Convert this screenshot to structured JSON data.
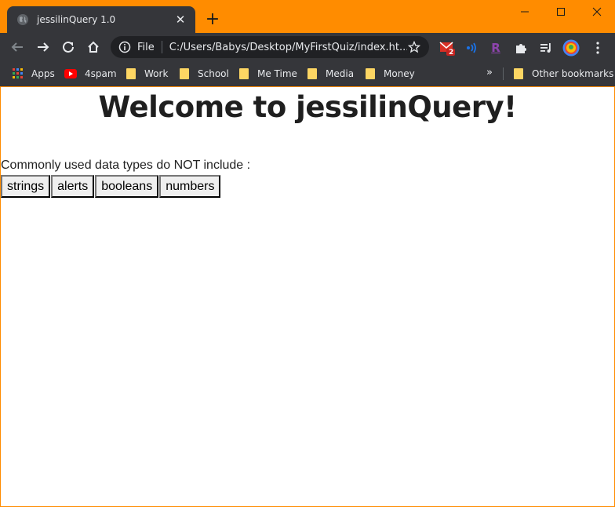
{
  "browser": {
    "tab": {
      "title": "jessilinQuery 1.0",
      "close_icon": "close-icon",
      "favicon": "globe-icon"
    },
    "new_tab_label": "+",
    "address_bar": {
      "scheme_label": "File",
      "url": "C:/Users/Babys/Desktop/MyFirstQuiz/index.ht..."
    },
    "extension_badge": "2",
    "bookmarks": [
      {
        "label": "Apps",
        "icon": "apps-grid-icon"
      },
      {
        "label": "4spam",
        "icon": "youtube-icon"
      },
      {
        "label": "Work",
        "icon": "folder-icon"
      },
      {
        "label": "School",
        "icon": "folder-icon"
      },
      {
        "label": "Me Time",
        "icon": "folder-icon"
      },
      {
        "label": "Media",
        "icon": "folder-icon"
      },
      {
        "label": "Money",
        "icon": "folder-icon"
      }
    ],
    "more_bookmarks": "»",
    "other_bookmarks": "Other bookmarks",
    "colors": {
      "frame": "#ff8c00",
      "toolbar": "#35363a",
      "omnibox": "#202124"
    }
  },
  "page": {
    "heading": "Welcome to jessilinQuery!",
    "question": "Commonly used data types do NOT include :",
    "answers": [
      "strings",
      "alerts",
      "booleans",
      "numbers"
    ]
  }
}
